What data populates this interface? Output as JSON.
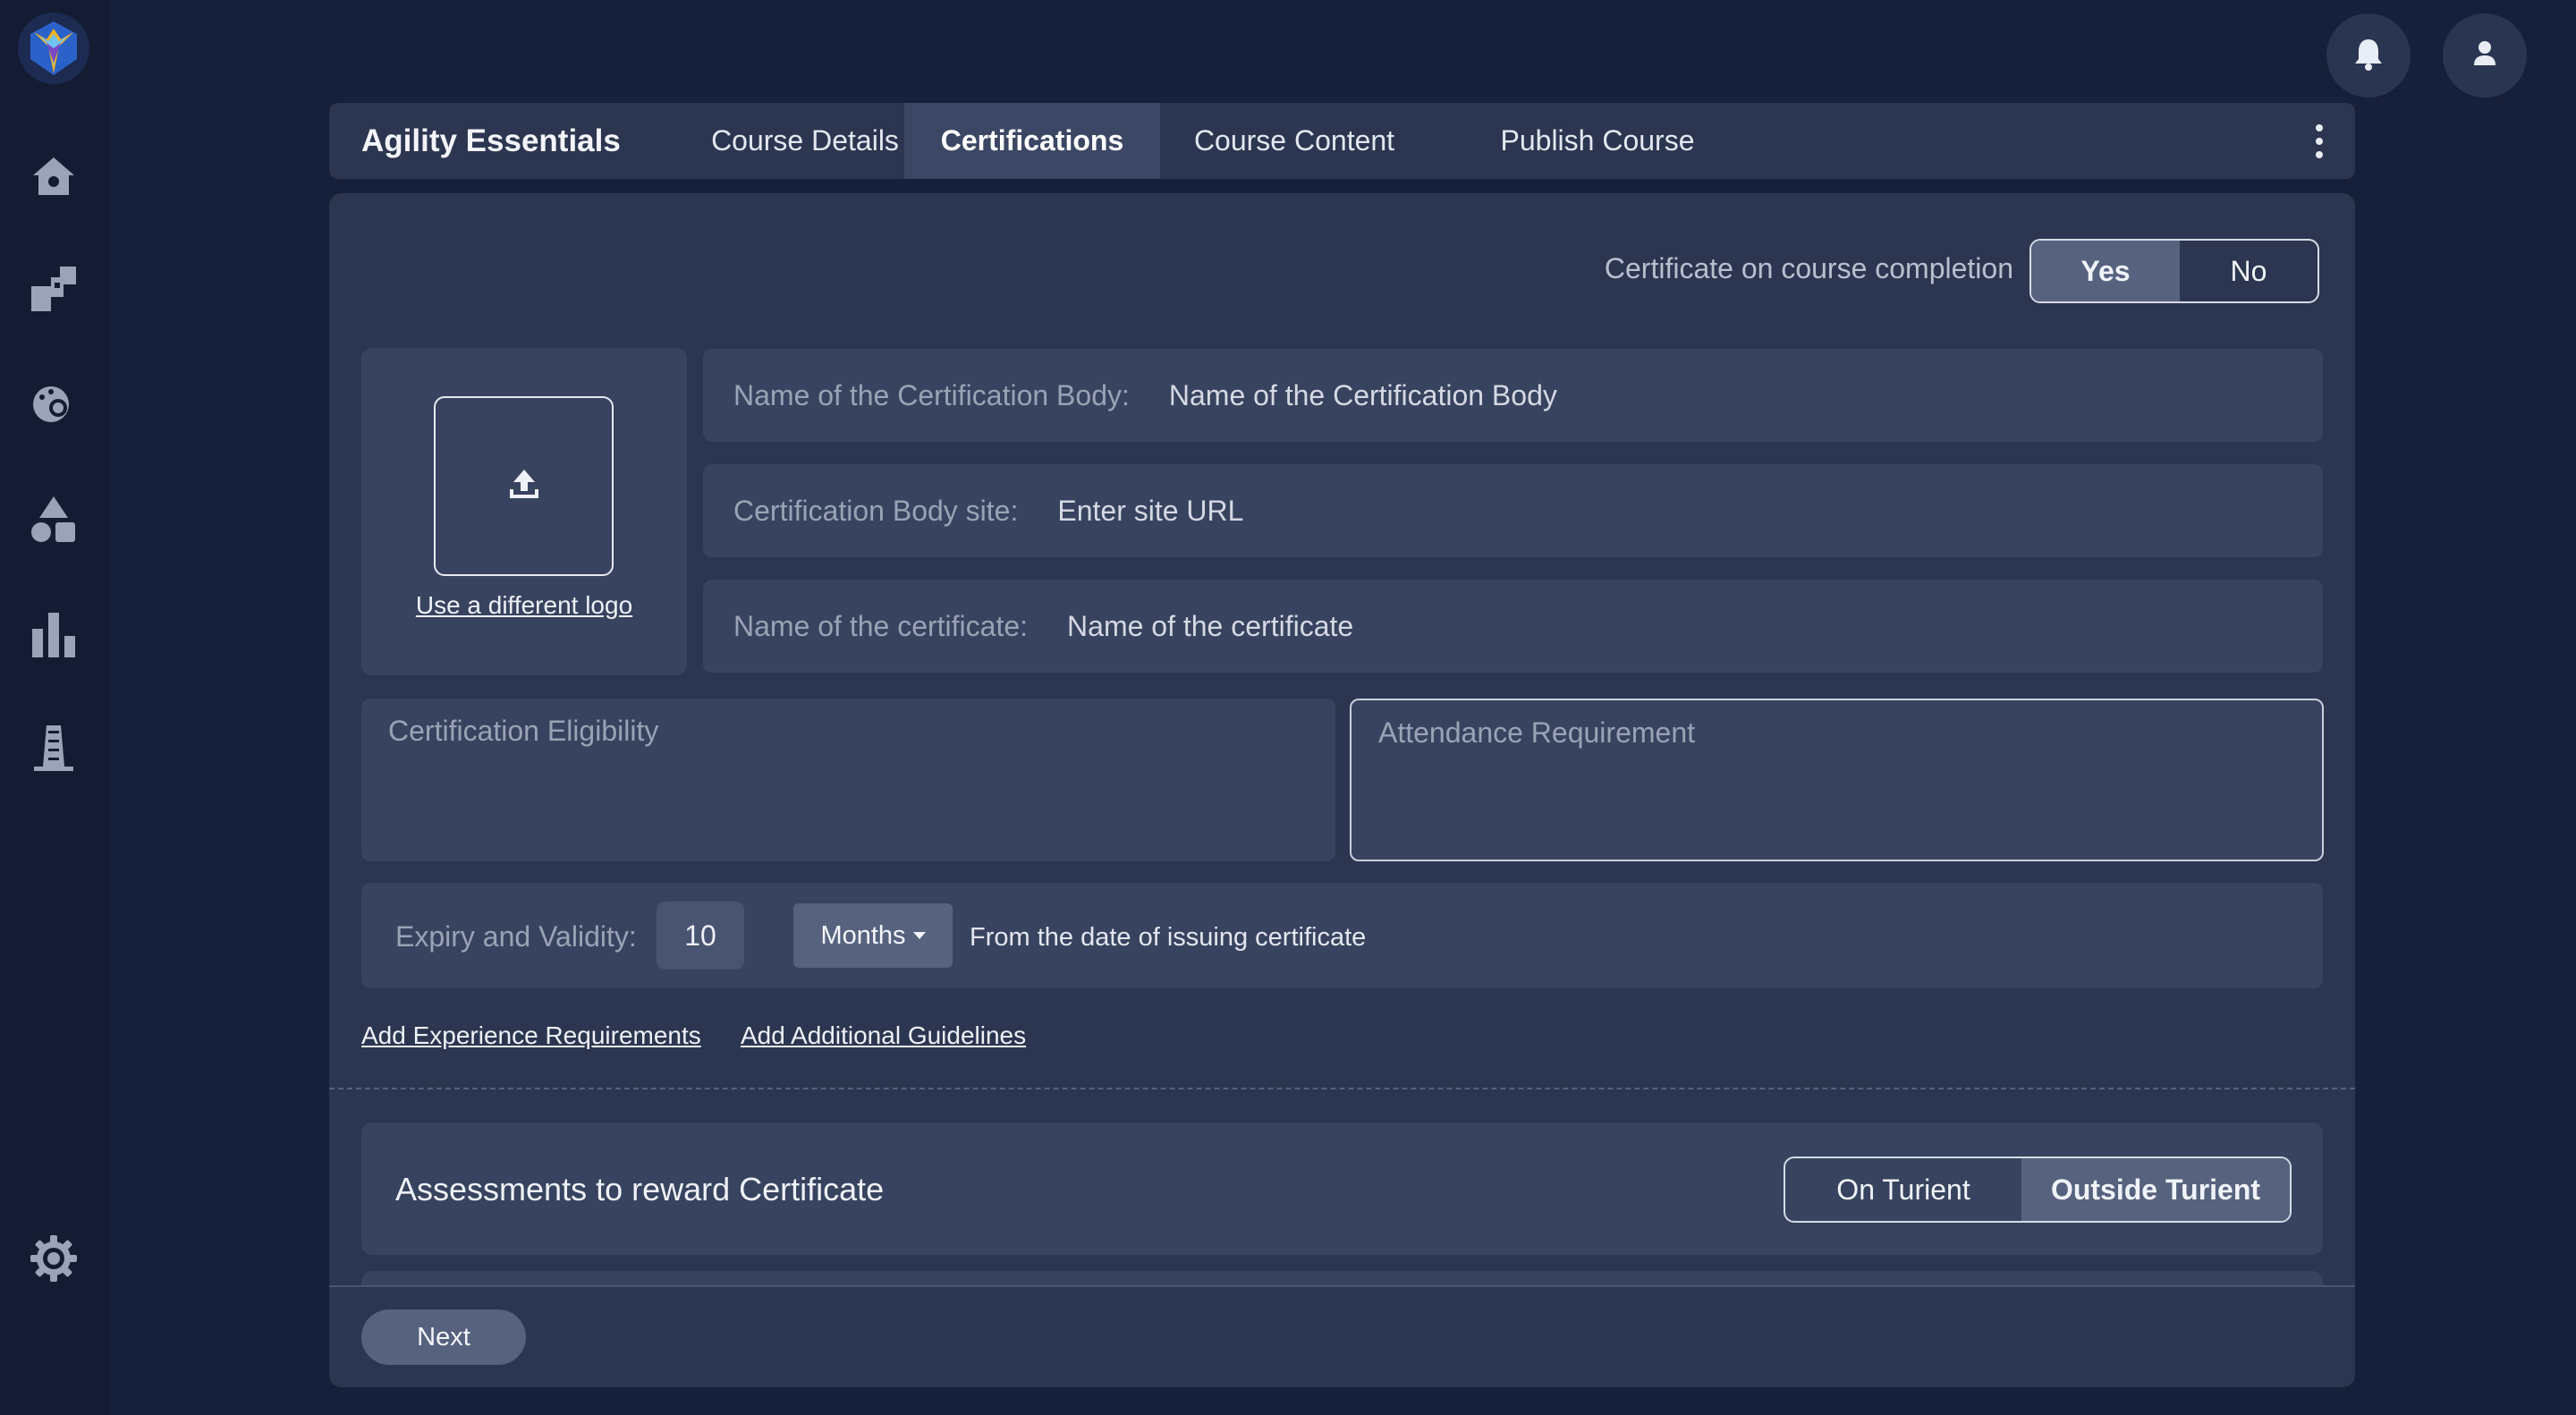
{
  "sidebar": {
    "logo": "app-logo",
    "items": [
      {
        "icon": "home-icon"
      },
      {
        "icon": "shapes-icon"
      },
      {
        "icon": "palette-icon"
      },
      {
        "icon": "triangle-shapes-icon"
      },
      {
        "icon": "bar-chart-icon"
      },
      {
        "icon": "building-icon"
      }
    ],
    "settings_icon": "gear-icon"
  },
  "topbar": {
    "notification_icon": "bell-icon",
    "profile_icon": "user-icon"
  },
  "header": {
    "course_title": "Agility Essentials",
    "tabs": [
      {
        "label": "Course Details",
        "active": false
      },
      {
        "label": "Certifications",
        "active": true
      },
      {
        "label": "Course Content",
        "active": false
      },
      {
        "label": "Publish Course",
        "active": false
      }
    ],
    "menu_icon": "kebab-menu-icon"
  },
  "certificate_toggle": {
    "label": "Certificate on course completion",
    "options": [
      "Yes",
      "No"
    ],
    "selected": "Yes"
  },
  "logo_upload": {
    "icon": "upload-icon",
    "link_label": "Use a different logo"
  },
  "fields": {
    "body_name": {
      "label": "Name of the Certification Body:",
      "placeholder": "Name of the Certification Body"
    },
    "body_site": {
      "label": "Certification Body site:",
      "placeholder": "Enter site URL"
    },
    "cert_name": {
      "label": "Name of the certificate:",
      "placeholder": "Name of the certificate"
    },
    "eligibility": {
      "placeholder": "Certification Eligibility"
    },
    "attendance": {
      "placeholder": "Attendance Requirement"
    }
  },
  "expiry": {
    "label": "Expiry and Validity:",
    "value": "10",
    "unit": "Months",
    "suffix": "From the date of issuing certificate"
  },
  "links": {
    "experience": "Add Experience Requirements",
    "guidelines": "Add Additional Guidelines"
  },
  "assessments": {
    "title": "Assessments to reward Certificate",
    "options": [
      "On Turient",
      "Outside Turient"
    ],
    "selected": "Outside Turient"
  },
  "footer": {
    "next_label": "Next"
  },
  "colors": {
    "background": "#17203a",
    "panel": "#2c3650",
    "field": "#38435f",
    "accent": "#56627e"
  }
}
